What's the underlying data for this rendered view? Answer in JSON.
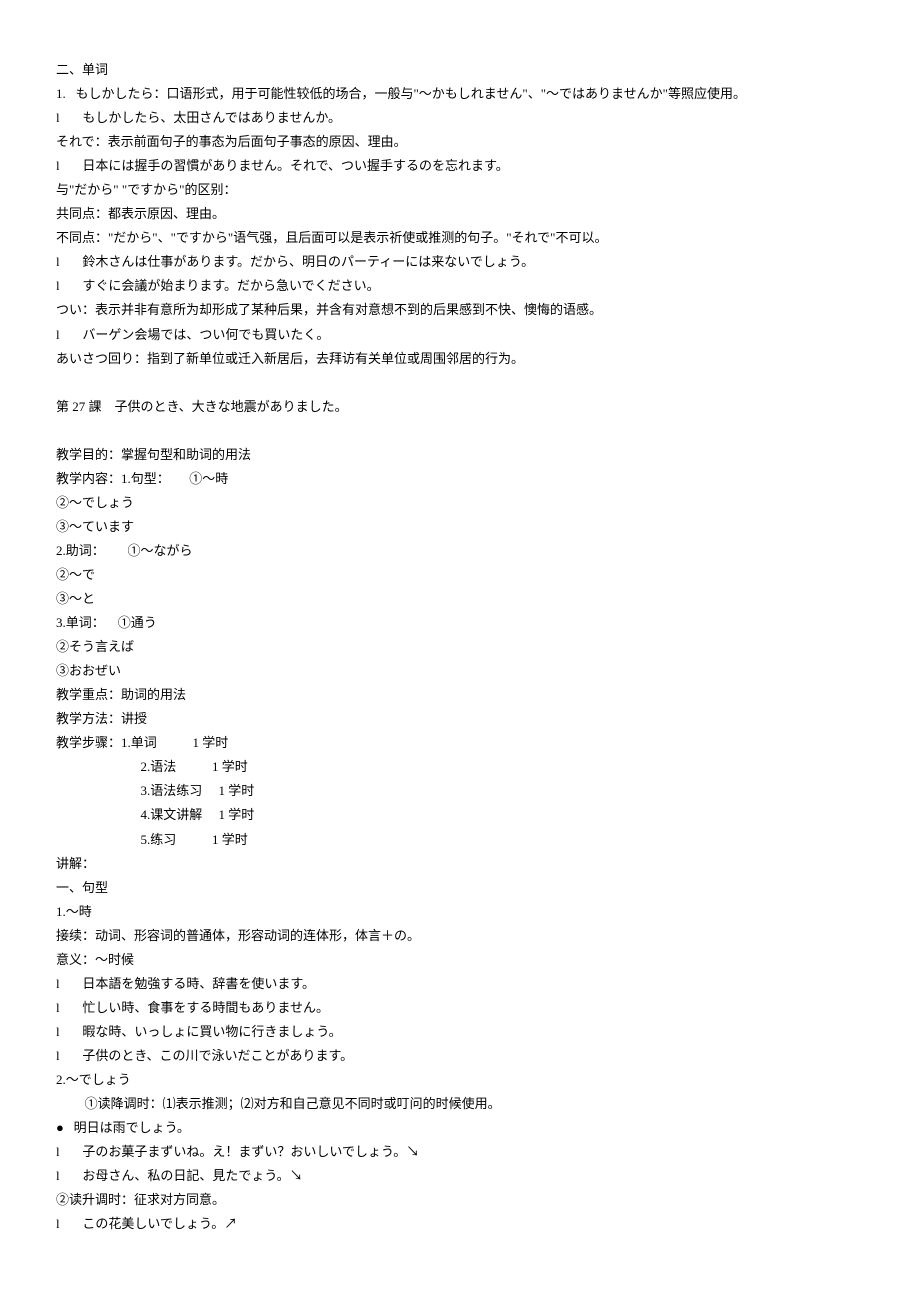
{
  "lines": [
    {
      "t": "二、单词"
    },
    {
      "t": "1.   もしかしたら：口语形式，用于可能性较低的场合，一般与\"～かもしれません\"、\"～ではありませんか\"等照应使用。"
    },
    {
      "t": "l       もしかしたら、太田さんではありませんか。"
    },
    {
      "t": "それで：表示前面句子的事态为后面句子事态的原因、理由。"
    },
    {
      "t": "l       日本には握手の習慣がありません。それで、つい握手するのを忘れます。"
    },
    {
      "t": "与\"だから\" \"ですから\"的区别："
    },
    {
      "t": "共同点：都表示原因、理由。"
    },
    {
      "t": "不同点：\"だから\"、\"ですから\"语气强，且后面可以是表示祈使或推测的句子。\"それで\"不可以。"
    },
    {
      "t": "l       鈴木さんは仕事があります。だから、明日のパーティーには来ないでしょう。"
    },
    {
      "t": "l       すぐに会議が始まります。だから急いでください。"
    },
    {
      "t": "つい：表示并非有意所为却形成了某种后果，并含有对意想不到的后果感到不快、懊悔的语感。"
    },
    {
      "t": "l       バーゲン会場では、つい何でも買いたく。"
    },
    {
      "t": "あいさつ回り：指到了新单位或迁入新居后，去拜访有关单位或周围邻居的行为。"
    },
    {
      "blank": true
    },
    {
      "t": "第 27 課　子供のとき、大きな地震がありました。"
    },
    {
      "blank": true
    },
    {
      "t": "教学目的：掌握句型和助词的用法"
    },
    {
      "t": "教学内容：1.句型：      ①～時"
    },
    {
      "t": "②～でしょう"
    },
    {
      "t": "③～ています"
    },
    {
      "t": "2.助词：       ①～ながら"
    },
    {
      "t": "②～で"
    },
    {
      "t": "③～と"
    },
    {
      "t": "3.单词：    ①通う"
    },
    {
      "t": "②そう言えば"
    },
    {
      "t": "③おおぜい"
    },
    {
      "t": "教学重点：助词的用法"
    },
    {
      "t": "教学方法：讲授"
    },
    {
      "t": "教学步骤：1.单词           1 学时"
    },
    {
      "cls": "ind-step",
      "t": "2.语法           1 学时"
    },
    {
      "cls": "ind-step",
      "t": "3.语法练习     1 学时"
    },
    {
      "cls": "ind-step",
      "t": "4.课文讲解     1 学时"
    },
    {
      "cls": "ind-step",
      "t": "5.练习           1 学时"
    },
    {
      "t": "讲解："
    },
    {
      "t": "一、句型"
    },
    {
      "t": "1.～時"
    },
    {
      "t": "接续：动词、形容词的普通体，形容动词的连体形，体言＋の。"
    },
    {
      "t": "意义：～时候"
    },
    {
      "t": "l       日本語を勉強する時、辞書を使います。"
    },
    {
      "t": "l       忙しい時、食事をする時間もありません。"
    },
    {
      "t": "l       暇な時、いっしょに買い物に行きましょう。"
    },
    {
      "t": "l       子供のとき、この川で泳いだことがあります。"
    },
    {
      "t": "2.～でしょう"
    },
    {
      "cls": "ind-bullet",
      "t": "①读降调时：⑴表示推测；⑵对方和自己意见不同时或叮问的时候使用。"
    },
    {
      "t": "●   明日は雨でしょう。"
    },
    {
      "t": "l       子のお菓子まずいね。え！まずい？おいしいでしょう。↘"
    },
    {
      "t": "l       お母さん、私の日記、見たでょう。↘"
    },
    {
      "t": "②读升调时：征求对方同意。"
    },
    {
      "t": "l       この花美しいでしょう。↗"
    }
  ]
}
